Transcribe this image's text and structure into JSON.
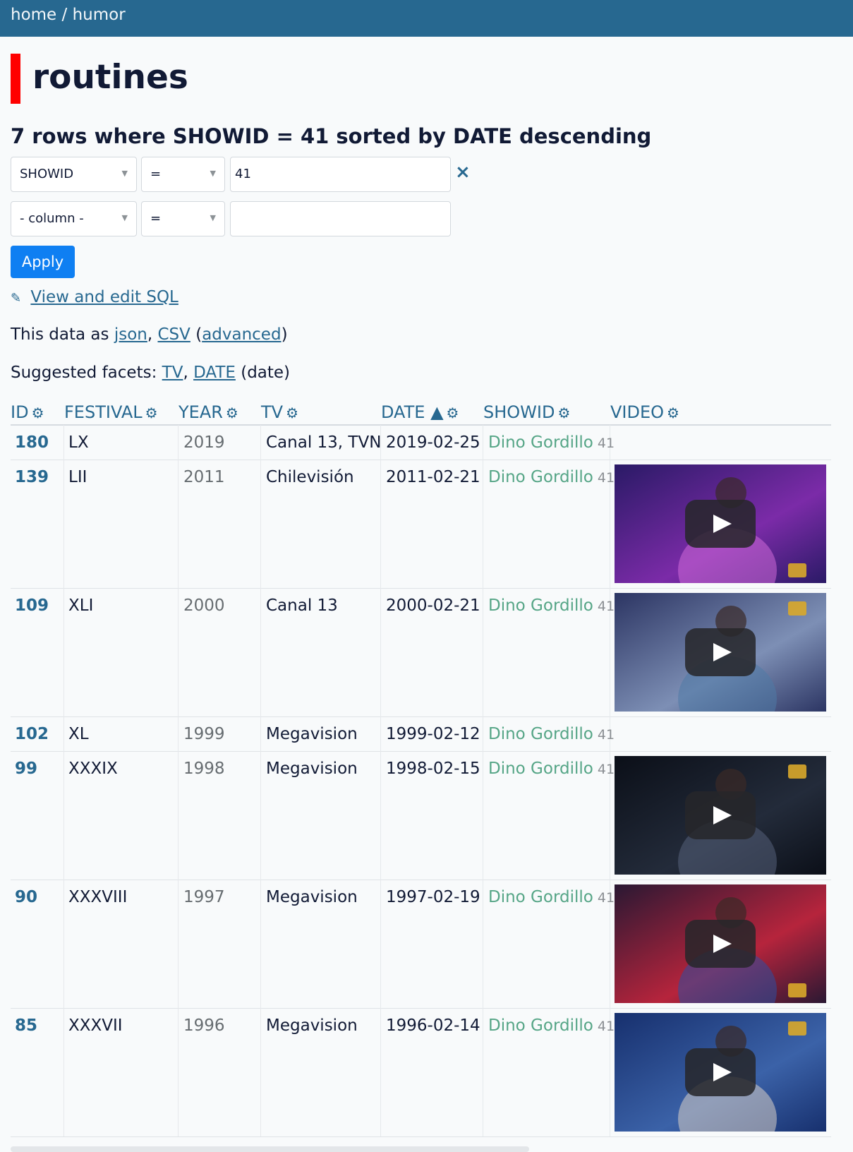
{
  "breadcrumb": {
    "home": "home",
    "sep": "/",
    "db": "humor"
  },
  "page_title": "routines",
  "subtitle": "7 rows where SHOWID = 41 sorted by DATE descending",
  "filters": [
    {
      "column": "SHOWID",
      "op": "=",
      "value": "41",
      "clear": "×"
    },
    {
      "column": "- column -",
      "op": "=",
      "value": ""
    }
  ],
  "apply_label": "Apply",
  "sql_link": "View and edit SQL",
  "export": {
    "prefix": "This data as",
    "json": "json",
    "comma": ",",
    "csv": "CSV",
    "open": "(",
    "advanced": "advanced",
    "close": ")"
  },
  "facets": {
    "prefix": "Suggested facets:",
    "tv": "TV",
    "comma": ",",
    "date": "DATE",
    "date_suffix": "(date)"
  },
  "columns": {
    "id": "ID",
    "festival": "FESTIVAL",
    "year": "YEAR",
    "tv": "TV",
    "date": "DATE ▲",
    "showid": "SHOWID",
    "video": "VIDEO"
  },
  "rows": [
    {
      "id": "180",
      "festival": "LX",
      "year": "2019",
      "tv": "Canal 13, TVN",
      "date": "2019-02-25",
      "show": "Dino Gordillo",
      "showid": "41",
      "video": ""
    },
    {
      "id": "139",
      "festival": "LII",
      "year": "2011",
      "tv": "Chilevisión",
      "date": "2011-02-21",
      "show": "Dino Gordillo",
      "showid": "41",
      "video": "video-thumbnail"
    },
    {
      "id": "109",
      "festival": "XLI",
      "year": "2000",
      "tv": "Canal 13",
      "date": "2000-02-21",
      "show": "Dino Gordillo",
      "showid": "41",
      "video": "video-thumbnail"
    },
    {
      "id": "102",
      "festival": "XL",
      "year": "1999",
      "tv": "Megavision",
      "date": "1999-02-12",
      "show": "Dino Gordillo",
      "showid": "41",
      "video": ""
    },
    {
      "id": "99",
      "festival": "XXXIX",
      "year": "1998",
      "tv": "Megavision",
      "date": "1998-02-15",
      "show": "Dino Gordillo",
      "showid": "41",
      "video": "video-thumbnail"
    },
    {
      "id": "90",
      "festival": "XXXVIII",
      "year": "1997",
      "tv": "Megavision",
      "date": "1997-02-19",
      "show": "Dino Gordillo",
      "showid": "41",
      "video": "video-thumbnail"
    },
    {
      "id": "85",
      "festival": "XXXVII",
      "year": "1996",
      "tv": "Megavision",
      "date": "1996-02-14",
      "show": "Dino Gordillo",
      "showid": "41",
      "video": "video-thumbnail"
    }
  ],
  "colors": {
    "header": "#276890",
    "accent": "#ff0000",
    "button": "#0f7ff2",
    "link": "#276890",
    "show_link": "#55a586"
  }
}
